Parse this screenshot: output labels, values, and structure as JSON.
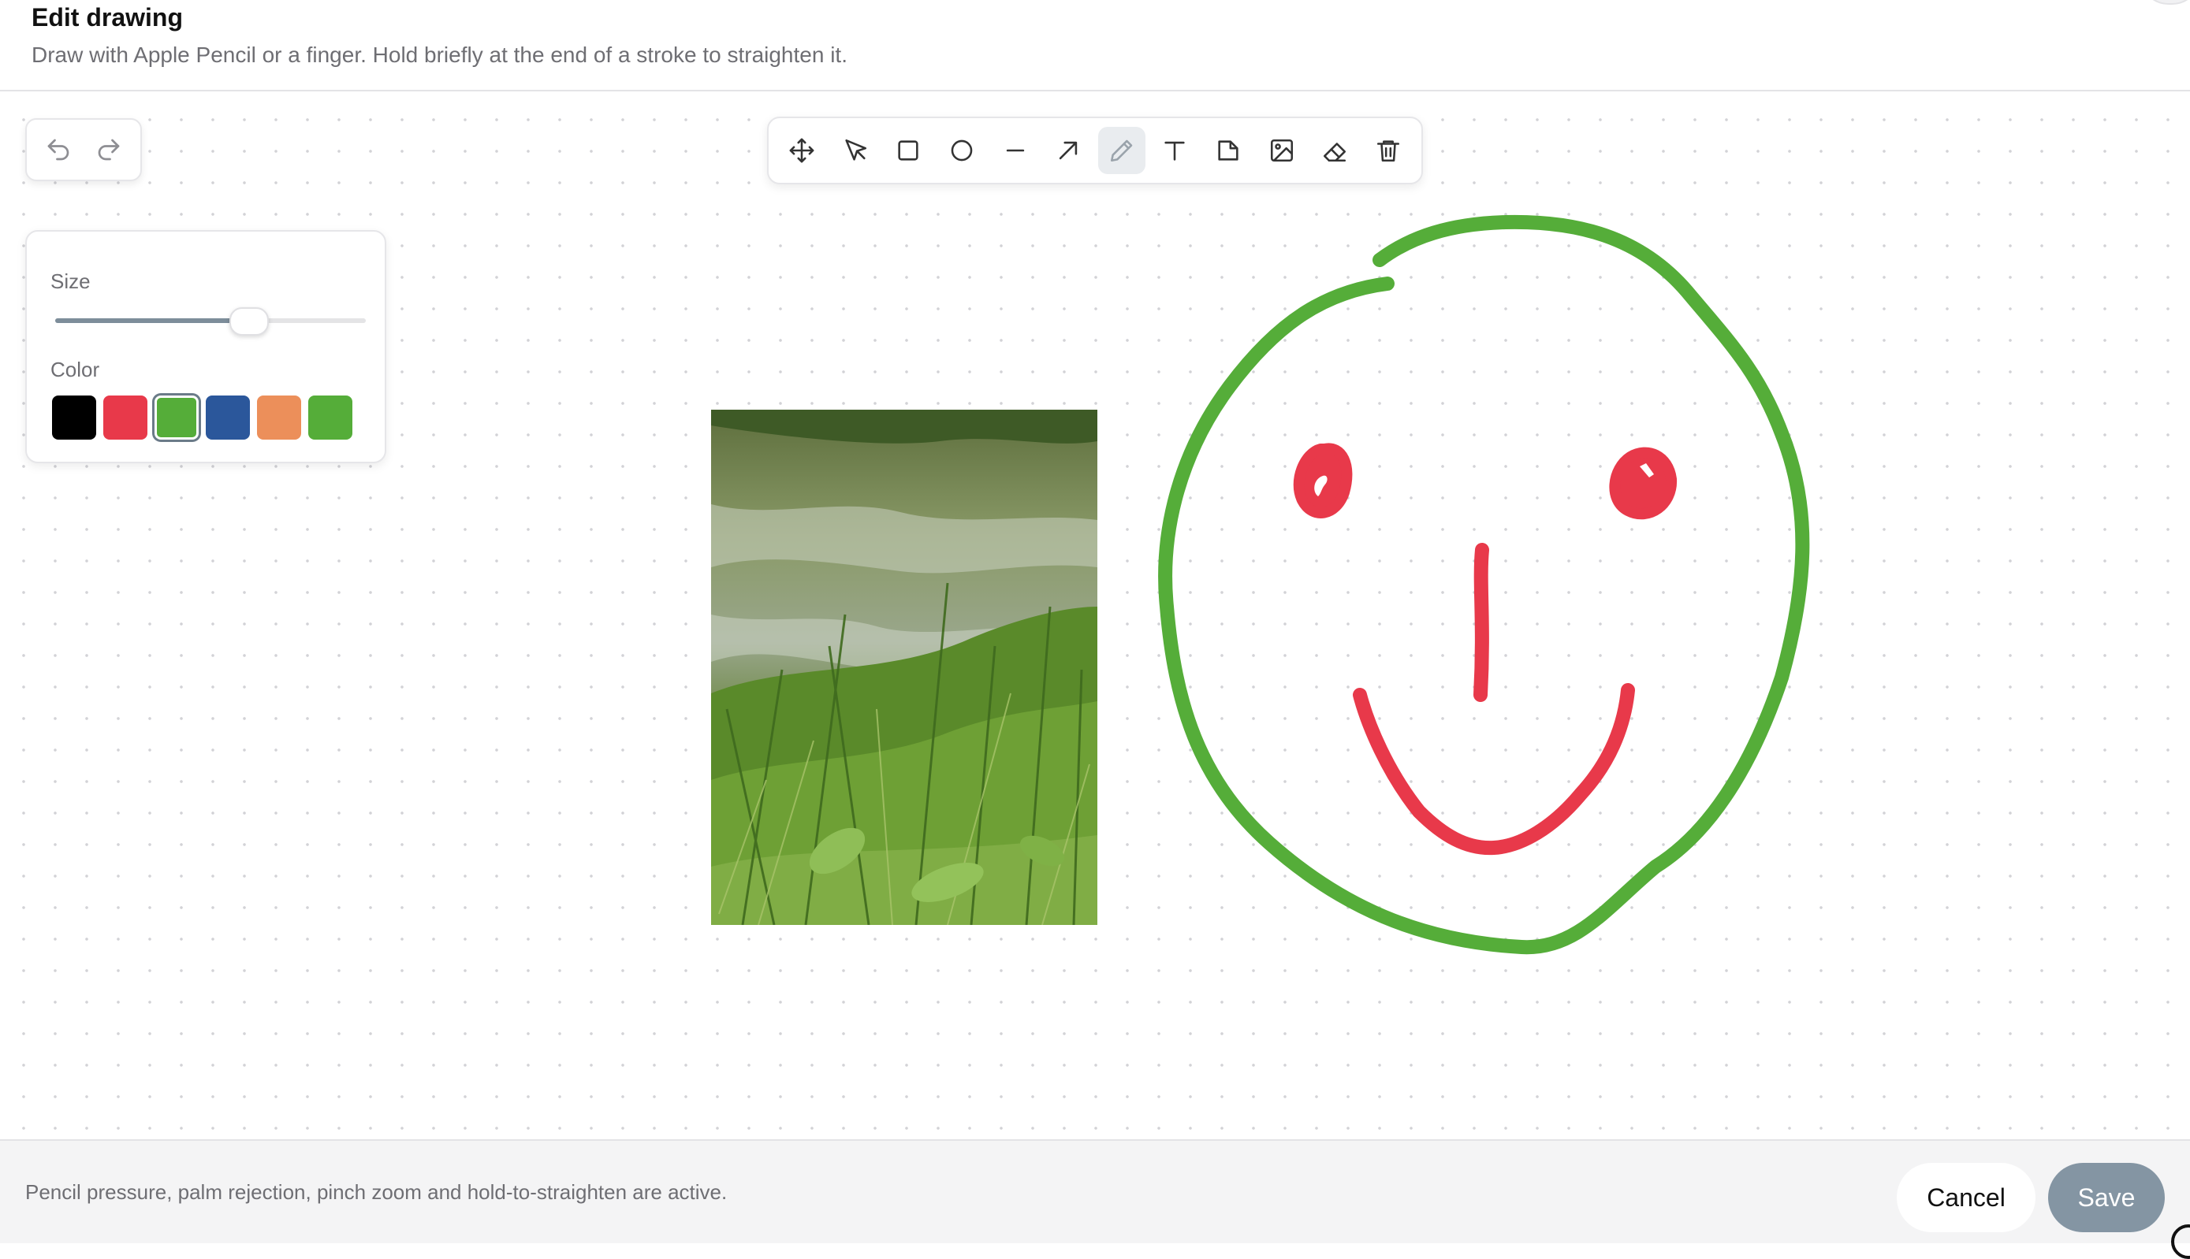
{
  "header": {
    "title": "Edit drawing",
    "subtitle": "Draw with Apple Pencil or a finger. Hold briefly at the end of a stroke to straighten it."
  },
  "history": {
    "undo": "undo-icon",
    "redo": "redo-icon"
  },
  "toolbar": {
    "tools": [
      {
        "name": "move",
        "icon": "move-icon"
      },
      {
        "name": "select",
        "icon": "cursor-icon"
      },
      {
        "name": "rectangle",
        "icon": "square-icon"
      },
      {
        "name": "ellipse",
        "icon": "circle-icon"
      },
      {
        "name": "line",
        "icon": "line-icon"
      },
      {
        "name": "arrow",
        "icon": "arrow-icon"
      },
      {
        "name": "pen",
        "icon": "pencil-icon",
        "active": true
      },
      {
        "name": "text",
        "icon": "text-icon"
      },
      {
        "name": "note",
        "icon": "note-icon"
      },
      {
        "name": "image",
        "icon": "image-icon"
      },
      {
        "name": "eraser",
        "icon": "eraser-icon"
      },
      {
        "name": "delete",
        "icon": "trash-icon"
      }
    ]
  },
  "properties": {
    "size_label": "Size",
    "size_value_fraction": 0.62,
    "color_label": "Color",
    "colors": [
      "#000000",
      "#e8394a",
      "#55ad39",
      "#2b579b",
      "#ec8f5a",
      "#55ad39"
    ],
    "selected_color_index": 2
  },
  "footer": {
    "note": "Pencil pressure, palm rejection, pinch zoom and hold-to-straighten are active.",
    "cancel_label": "Cancel",
    "save_label": "Save"
  },
  "colors": {
    "stroke_green": "#55ad39",
    "stroke_red": "#e8394a",
    "save_button": "#8495a3"
  }
}
